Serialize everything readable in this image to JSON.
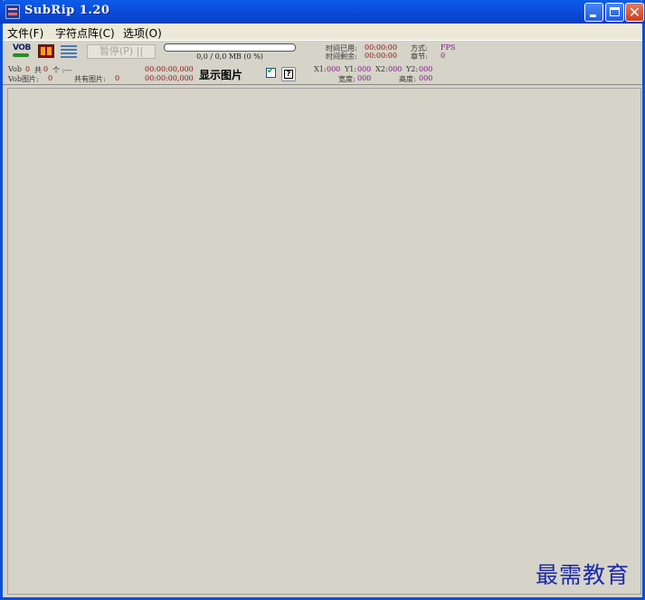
{
  "window": {
    "title": "SubRip 1.20"
  },
  "menu": {
    "file": "文件(F)",
    "charmatrix": "字符点阵(C)",
    "options": "选项(O)"
  },
  "toolbar": {
    "vob_label": "VOB",
    "pause_label": "暂停(P) ||",
    "progress_percent": 0,
    "progress_text": "0,0 / 0,0 MB (0 %)",
    "time_used_label": "时间已用:",
    "time_used_value": "00:00:00",
    "time_remaining_label": "时间剩余:",
    "time_remaining_value": "00:00:00",
    "mode_label": "方式:",
    "mode_value": "FPS",
    "chapter_label": "章节:",
    "chapter_value": "0"
  },
  "info": {
    "vob_label": "Vob",
    "vob_value": "0",
    "total_label": "共",
    "total_value": "0",
    "count_unit": "个 :---",
    "vob_images_label": "Vob图片:",
    "vob_images_value": "0",
    "total_images_label": "共有图片:",
    "total_images_value": "0",
    "time1": "00:00:00,000",
    "time2": "00:00:00,000",
    "show_image_label": "显示图片",
    "show_image_checked": true,
    "x1_label": "X1:",
    "x1_value": "000",
    "y1_label": "Y1:",
    "y1_value": "000",
    "x2_label": "X2:",
    "x2_value": "000",
    "y2_label": "Y2:",
    "y2_value": "000",
    "width_label": "宽度:",
    "width_value": "000",
    "height_label": "高度:",
    "height_value": "000"
  },
  "watermark": "最需教育"
}
